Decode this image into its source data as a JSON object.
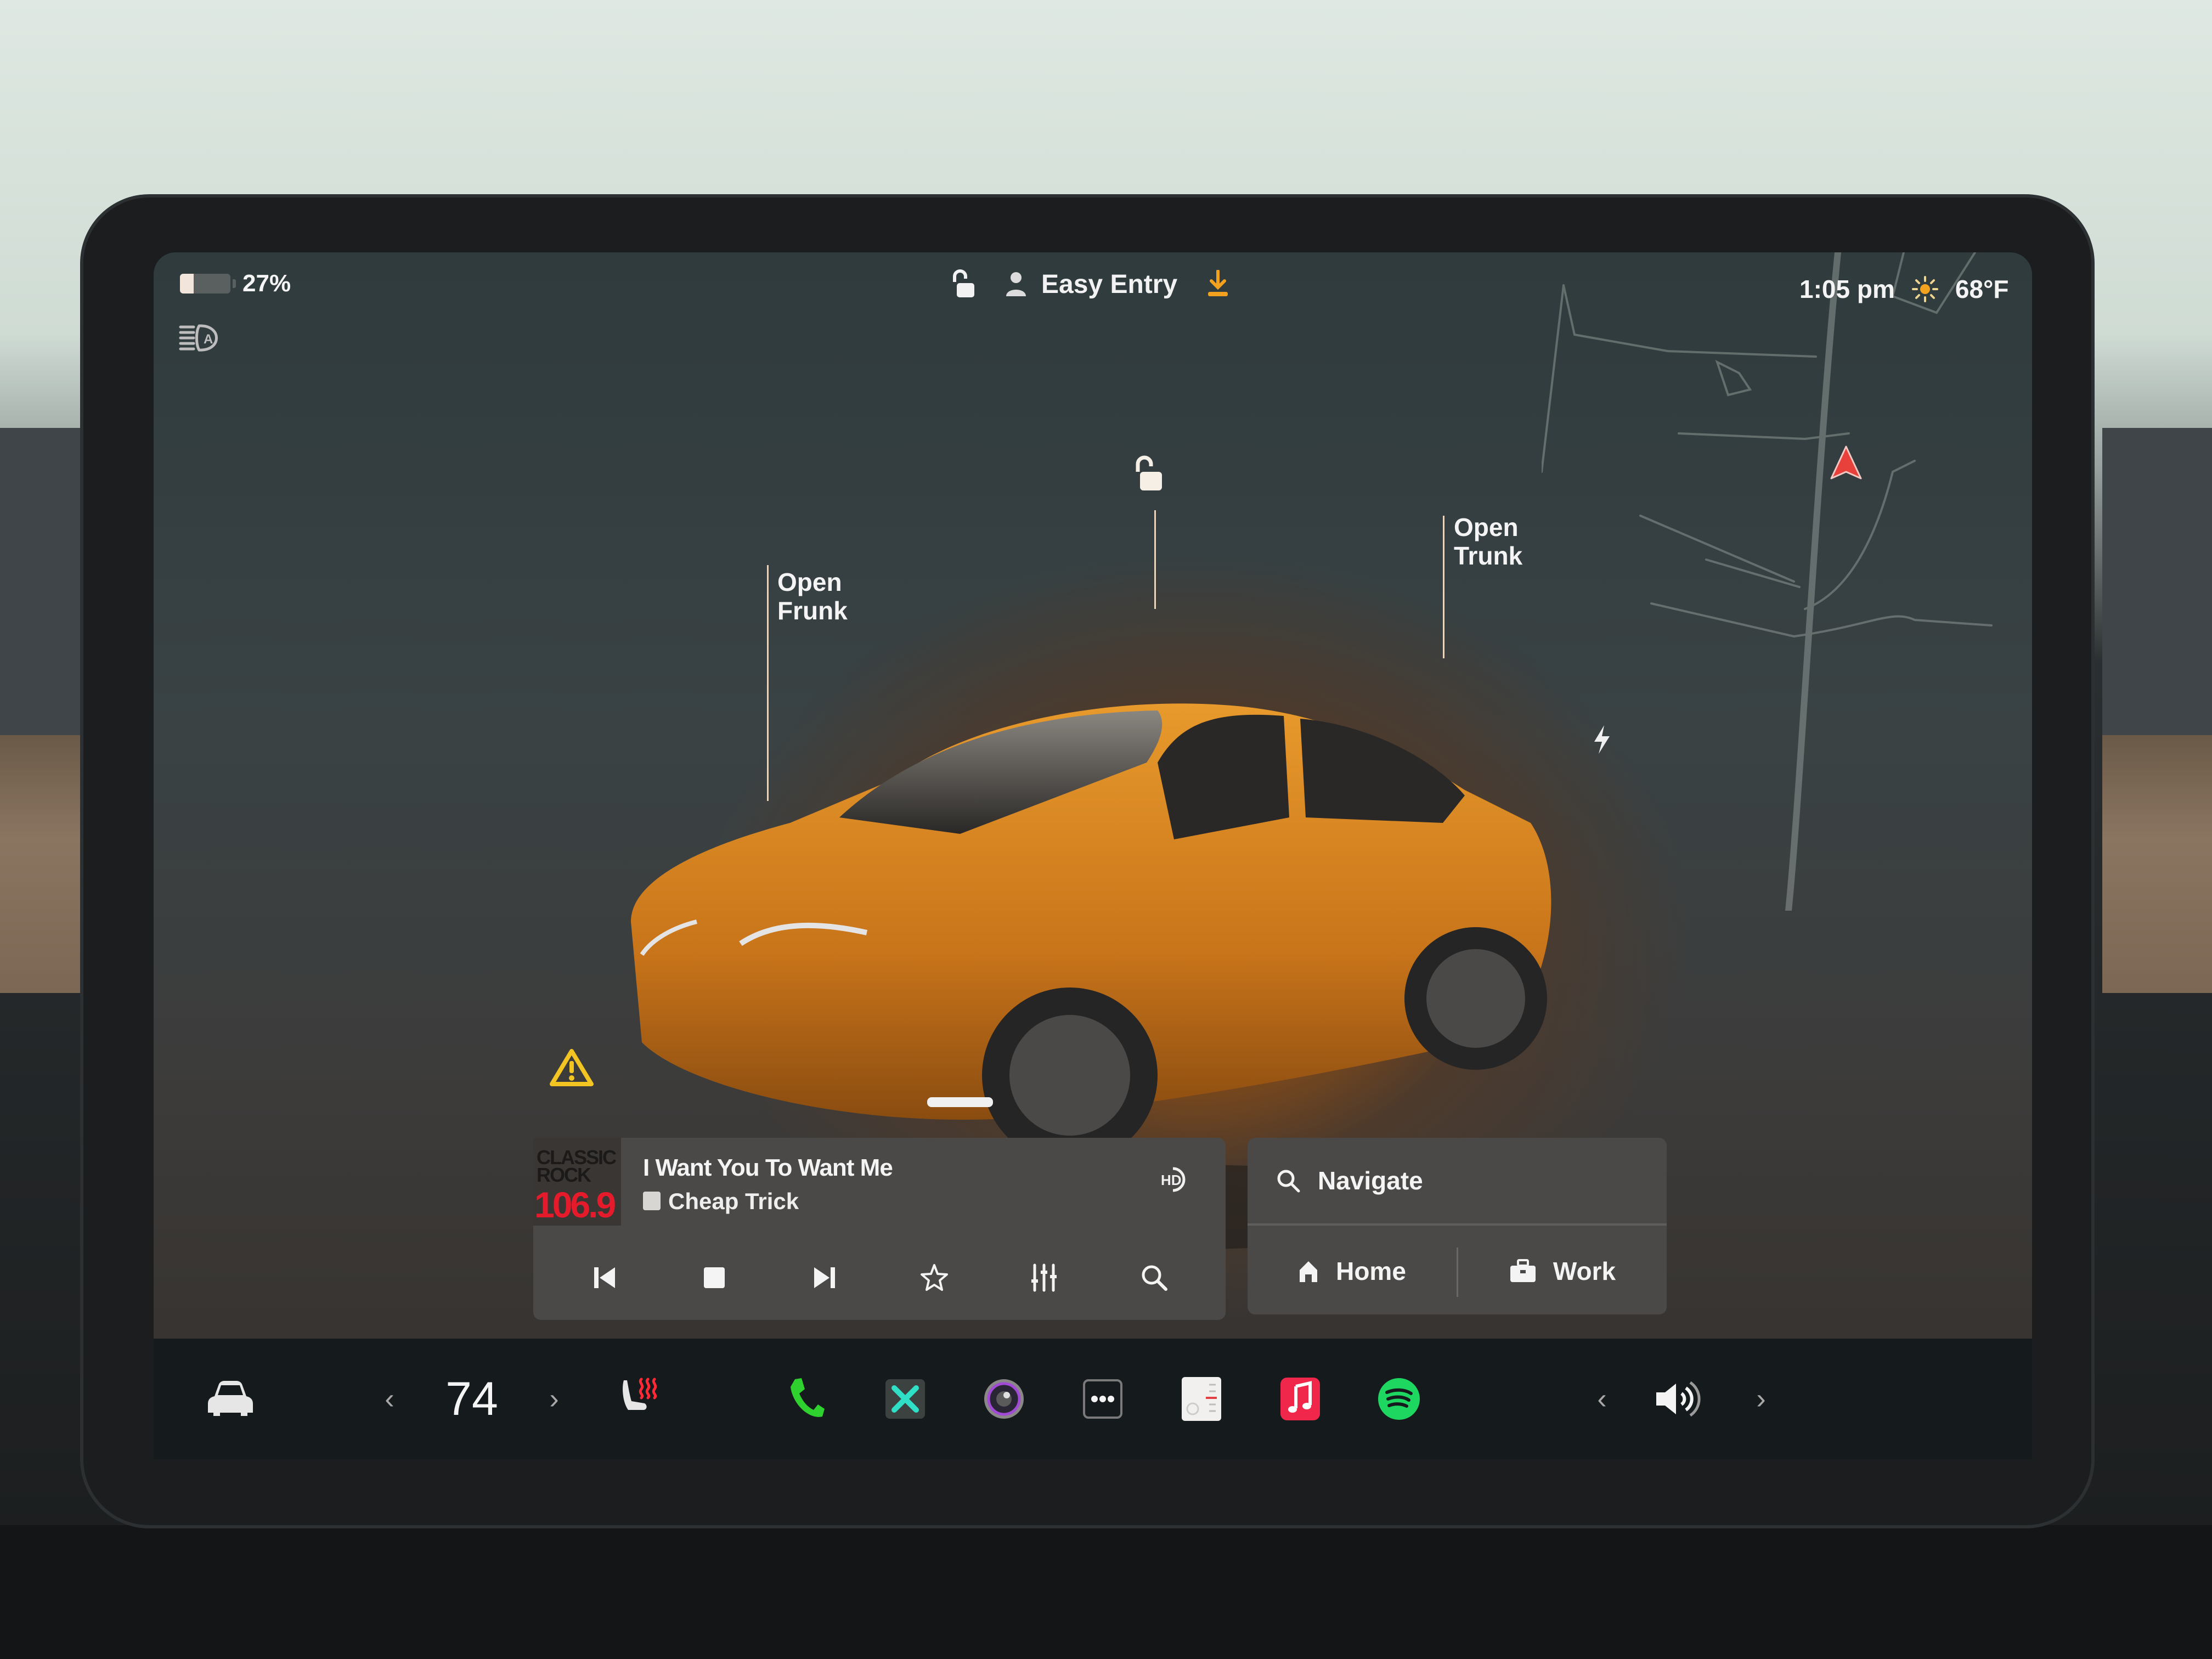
{
  "status_bar": {
    "battery_percent": 27,
    "battery_label": "27%",
    "driver_profile": "Easy Entry",
    "time": "1:05 pm",
    "temperature_outside": "68°F",
    "weather_icon": "sun-icon",
    "icons": [
      "battery-icon",
      "auto-headlights-icon",
      "unlocked-icon",
      "user-profile-icon",
      "software-update-download-icon"
    ]
  },
  "vehicle": {
    "open_frunk_label_line1": "Open",
    "open_frunk_label_line2": "Frunk",
    "open_trunk_label_line1": "Open",
    "open_trunk_label_line2": "Trunk",
    "lock_state": "unlocked",
    "paint_color": "#c8741a",
    "charge_port_icon": "lightning-bolt-icon",
    "alert_icon": "warning-triangle-icon"
  },
  "media": {
    "station_logo_line1": "CLASSIC",
    "station_logo_line2": "ROCK",
    "station_frequency": "106.9",
    "track_title": "I Want You To Want Me",
    "artist": "Cheap Trick",
    "hd_badge": "HD",
    "controls": [
      "previous-icon",
      "stop-icon",
      "next-icon",
      "favorite-star-icon",
      "equalizer-icon",
      "search-icon"
    ]
  },
  "navigation": {
    "search_label": "Navigate",
    "home_label": "Home",
    "work_label": "Work"
  },
  "dock": {
    "cabin_temperature": "74",
    "temp_decrease": "‹",
    "temp_increase": "›",
    "volume_decrease": "‹",
    "volume_increase": "›",
    "apps": [
      "phone",
      "toybox",
      "camera",
      "more",
      "calendar",
      "apple-music",
      "spotify"
    ]
  },
  "colors": {
    "accent_orange": "#f2a21e",
    "warning_yellow": "#f3c522",
    "nav_arrow_red": "#e8403a",
    "phone_green": "#2fd12f",
    "spotify_green": "#1ed760",
    "music_red": "#f0264a",
    "seat_heat_red": "#ff2a36"
  }
}
